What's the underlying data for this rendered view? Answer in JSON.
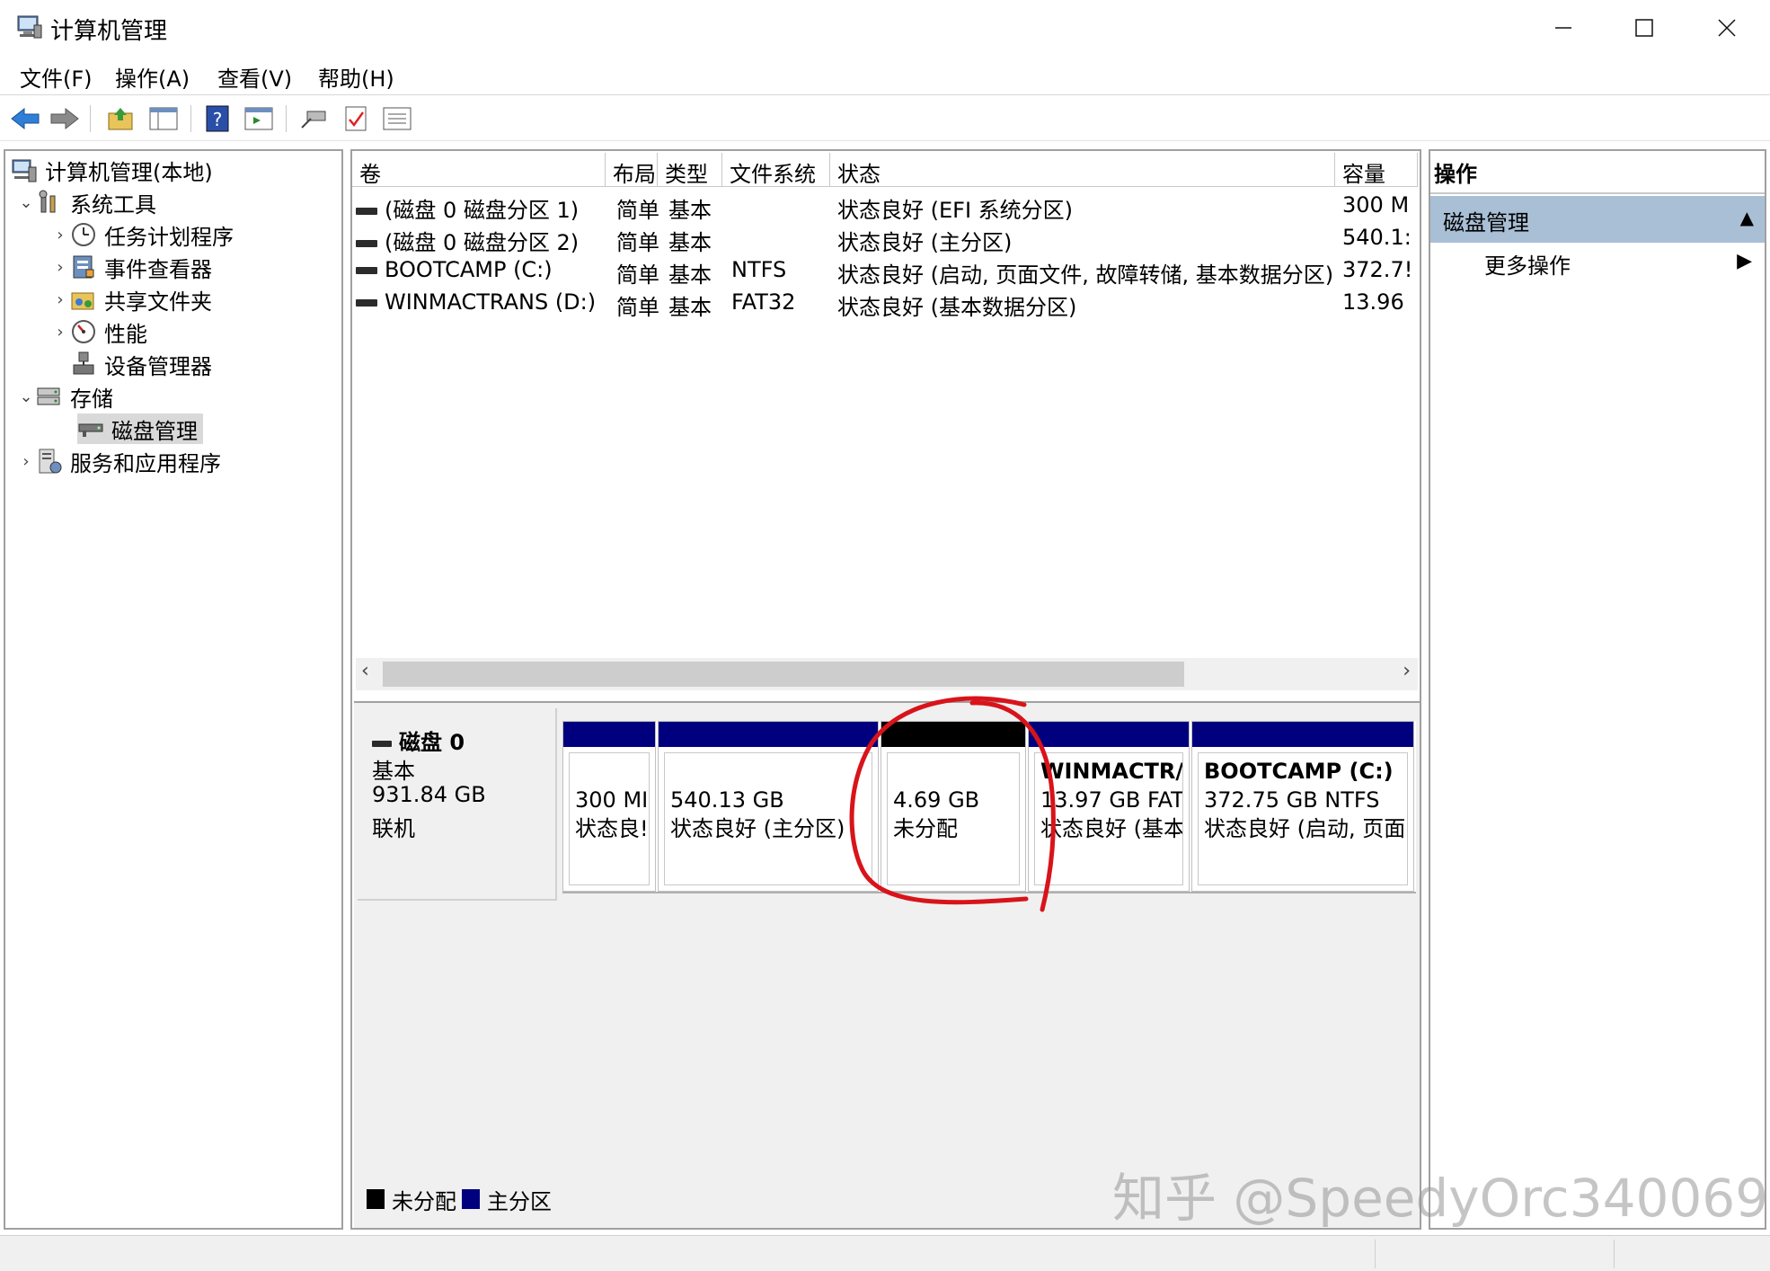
{
  "window": {
    "title": "计算机管理",
    "minimize_icon": "minimize-icon",
    "maximize_icon": "maximize-icon",
    "close_icon": "close-icon"
  },
  "menu": {
    "items": [
      {
        "label": "文件(F)"
      },
      {
        "label": "操作(A)"
      },
      {
        "label": "查看(V)"
      },
      {
        "label": "帮助(H)"
      }
    ]
  },
  "toolbar": {
    "icons": [
      "back-arrow-icon",
      "forward-arrow-icon",
      "up-folder-icon",
      "show-hide-tree-icon",
      "help-icon",
      "properties-icon",
      "connect-icon",
      "check-icon",
      "list-icon"
    ]
  },
  "tree": {
    "root": "计算机管理(本地)",
    "system_tools": "系统工具",
    "task_scheduler": "任务计划程序",
    "event_viewer": "事件查看器",
    "shared_folders": "共享文件夹",
    "performance": "性能",
    "device_manager": "设备管理器",
    "storage": "存储",
    "disk_management": "磁盘管理",
    "services_apps": "服务和应用程序"
  },
  "volumes": {
    "headers": {
      "volume": "卷",
      "layout": "布局",
      "type": "类型",
      "filesystem": "文件系统",
      "status": "状态",
      "capacity": "容量"
    },
    "rows": [
      {
        "volume": "(磁盘 0 磁盘分区 1)",
        "layout": "简单",
        "type": "基本",
        "filesystem": "",
        "status": "状态良好 (EFI 系统分区)",
        "capacity": "300 M"
      },
      {
        "volume": "(磁盘 0 磁盘分区 2)",
        "layout": "简单",
        "type": "基本",
        "filesystem": "",
        "status": "状态良好 (主分区)",
        "capacity": "540.1:"
      },
      {
        "volume": "BOOTCAMP (C:)",
        "layout": "简单",
        "type": "基本",
        "filesystem": "NTFS",
        "status": "状态良好 (启动, 页面文件, 故障转储, 基本数据分区)",
        "capacity": "372.7!"
      },
      {
        "volume": "WINMACTRANS (D:)",
        "layout": "简单",
        "type": "基本",
        "filesystem": "FAT32",
        "status": "状态良好 (基本数据分区)",
        "capacity": "13.96"
      }
    ]
  },
  "disk": {
    "name": "磁盘 0",
    "kind": "基本",
    "size": "931.84 GB",
    "state": "联机",
    "partitions": [
      {
        "title": "",
        "line1": "300 MI",
        "line2": "状态良!",
        "bar_color": "#00007f"
      },
      {
        "title": "",
        "line1": "540.13 GB",
        "line2": "状态良好 (主分区)",
        "bar_color": "#00007f"
      },
      {
        "title": "",
        "line1": "4.69 GB",
        "line2": "未分配",
        "bar_color": "#000000"
      },
      {
        "title": "WINMACTR/",
        "line1": "13.97 GB FAT",
        "line2": "状态良好 (基本",
        "bar_color": "#00007f"
      },
      {
        "title": "BOOTCAMP  (C:)",
        "line1": "372.75 GB NTFS",
        "line2": "状态良好 (启动, 页面",
        "bar_color": "#00007f"
      }
    ]
  },
  "legend": {
    "unallocated": "未分配",
    "unallocated_color": "#000000",
    "primary": "主分区",
    "primary_color": "#00007f"
  },
  "actions": {
    "title": "操作",
    "section": "磁盘管理",
    "more": "更多操作"
  },
  "watermark": "知乎 @SpeedyOrc340069",
  "colors": {
    "annotation": "#d8141a",
    "selection_header": "#a9bfd6"
  }
}
